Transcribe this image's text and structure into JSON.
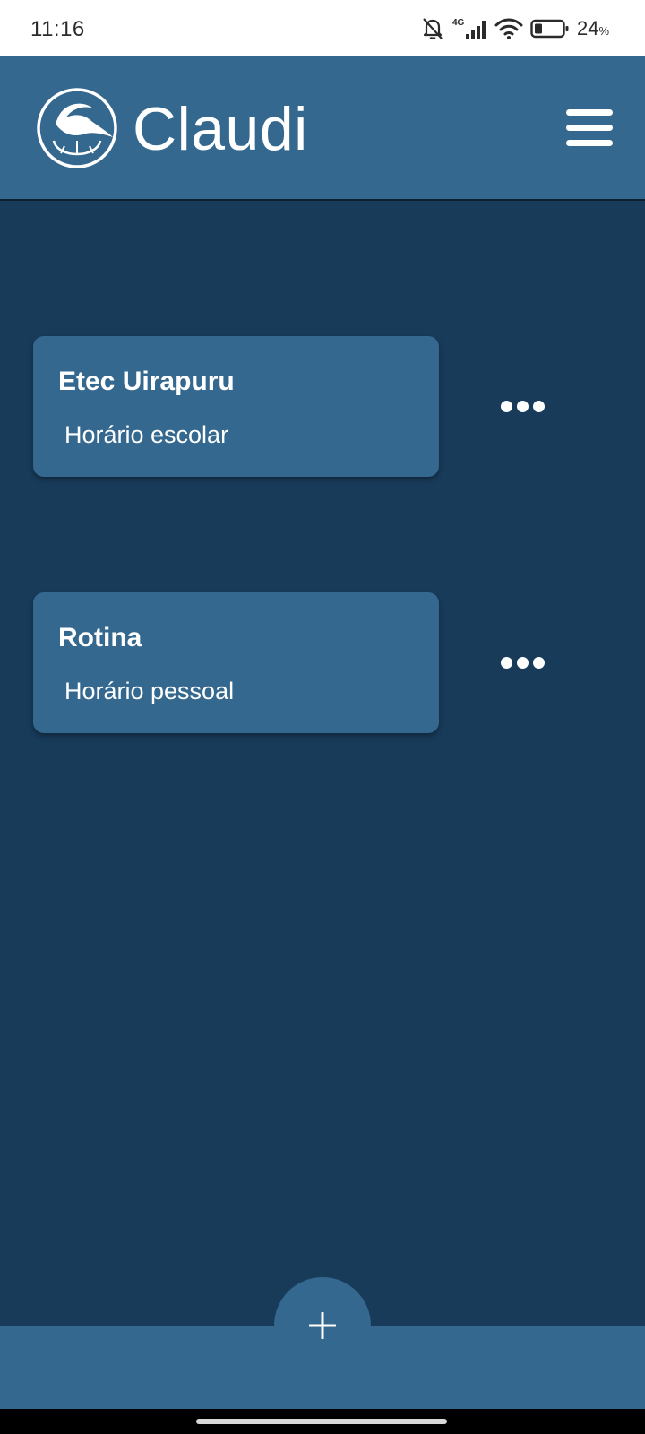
{
  "status_bar": {
    "time": "11:16",
    "network_label": "4G",
    "battery_percent": "24",
    "battery_percent_sign": "%",
    "icons": [
      "bell-muted-icon",
      "signal-4g-icon",
      "wifi-icon",
      "battery-icon"
    ]
  },
  "header": {
    "app_name": "Claudi",
    "logo_icon": "bird-globe-logo-icon",
    "menu_icon": "hamburger-menu-icon"
  },
  "schedules": [
    {
      "title": "Etec Uirapuru",
      "subtitle": "Horário escolar",
      "options_icon": "more-horizontal-icon"
    },
    {
      "title": "Rotina",
      "subtitle": "Horário pessoal",
      "options_icon": "more-horizontal-icon"
    }
  ],
  "fab": {
    "icon": "plus-icon"
  },
  "colors": {
    "background": "#183b5a",
    "primary": "#34688f",
    "on_primary": "#ffffff",
    "status_bar": "#ffffff"
  }
}
